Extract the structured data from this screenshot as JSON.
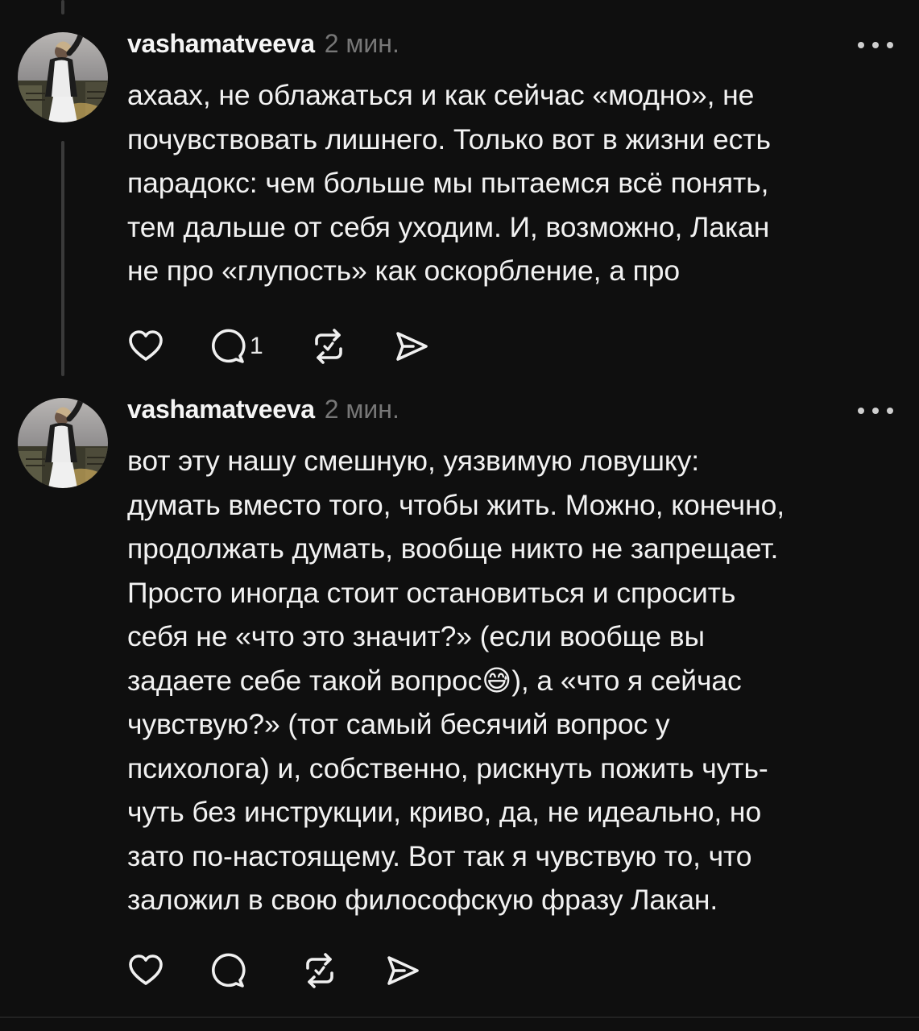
{
  "theme": {
    "background": "#0f0f0f",
    "text": "#f2f2f2",
    "muted": "#777777",
    "thread_line": "#3a3a3a"
  },
  "posts": [
    {
      "username": "vashamatveeva",
      "time": "2 мин.",
      "text": "ахаах, не облажаться и как сейчас «модно», не\nпочувствовать лишнего. Только вот в жизни есть\nпарадокс: чем больше мы пытаемся всё понять,\nтем дальше от себя уходим. И, возможно, Лакан\nне про «глупость» как оскорбление, а про",
      "reply_count": "1",
      "icons": [
        "heart-icon",
        "comment-icon",
        "repost-icon",
        "share-icon",
        "more-icon"
      ]
    },
    {
      "username": "vashamatveeva",
      "time": "2 мин.",
      "text": "вот эту нашу смешную, уязвимую ловушку:\nдумать вместо того, чтобы жить. Можно, конечно,\nпродолжать думать, вообще никто не запрещает.\nПросто иногда стоит остановиться и спросить\nсебя не «что это значит?» (если вообще вы\nзадаете себе такой вопрос😅), а «что я сейчас\nчувствую?» (тот самый бесячий вопрос у\nпсихолога) и, собственно, рискнуть пожить чуть-\nчуть без инструкции, криво, да, не идеально, но\nзато по-настоящему. Вот так я чувствую то, что\nзаложил в свою философскую фразу Лакан.",
      "reply_count": "",
      "icons": [
        "heart-icon",
        "comment-icon",
        "repost-icon",
        "share-icon",
        "more-icon"
      ]
    }
  ]
}
